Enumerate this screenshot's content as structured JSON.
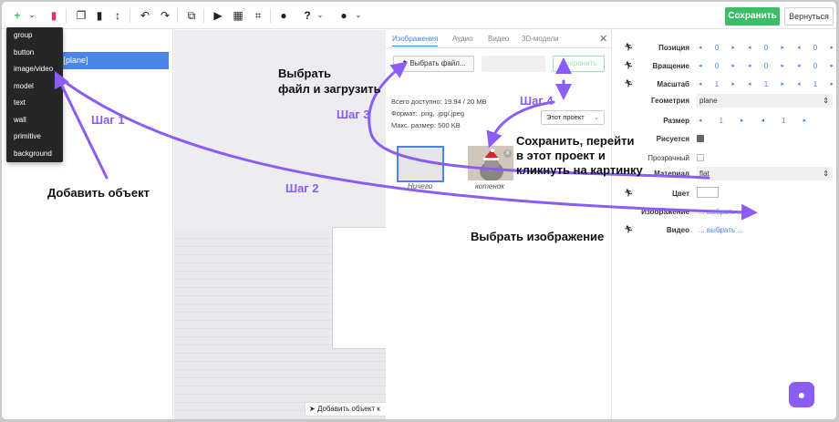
{
  "toolbar": {
    "add_icon": "plus-icon",
    "save_label": "Сохранить",
    "back_label": "Вернуться"
  },
  "add_menu": {
    "items": [
      "group",
      "button",
      "image/video",
      "model",
      "text",
      "wall",
      "primitive",
      "background"
    ]
  },
  "tree": {
    "selected_item": "[window] [plane]"
  },
  "scene": {
    "add_object_hint": "Добавить объект к"
  },
  "media_panel": {
    "tabs": [
      "Изображения",
      "Аудио",
      "Видео",
      "3D-модели"
    ],
    "choose_file_label": "Выбрать файл...",
    "save_label": "Сохранить",
    "available": "Всего доступно: 19.94 / 20 MB",
    "formats": "Формат: .png, .jpg/.jpeg",
    "max_size": "Макс. размер: 500 KB",
    "project_select": "Этот проект",
    "thumbnails": [
      {
        "caption": "Ничего"
      },
      {
        "caption": "котенок"
      }
    ]
  },
  "properties": {
    "position": {
      "label": "Позиция",
      "values": [
        "0",
        "0",
        "0"
      ]
    },
    "rotation": {
      "label": "Вращение",
      "values": [
        "0",
        "0",
        "0"
      ]
    },
    "scale": {
      "label": "Масштаб",
      "values": [
        "1",
        "1",
        "1"
      ]
    },
    "geometry": {
      "label": "Геометрия",
      "value": "plane"
    },
    "size": {
      "label": "Размер",
      "values": [
        "1",
        "1"
      ]
    },
    "visible": {
      "label": "Рисуется",
      "checked": true
    },
    "transparent": {
      "label": "Прозрачный",
      "checked": false
    },
    "material": {
      "label": "Материал",
      "value": "flat"
    },
    "color": {
      "label": "Цвет",
      "value": "#ffffff"
    },
    "image": {
      "label": "Изображение",
      "link": "... выбрать ..."
    },
    "video": {
      "label": "Видео",
      "link": "... выбрать ..."
    }
  },
  "annotations": {
    "add_object": "Добавить объект",
    "choose_upload_1": "Выбрать",
    "choose_upload_2": "файл и загрузить",
    "save_go_1": "Сохранить, перейти",
    "save_go_2": "в этот проект и",
    "save_go_3": "кликнуть на картинку",
    "choose_image": "Выбрать изображение",
    "step1": "Шаг 1",
    "step2": "Шаг 2",
    "step3": "Шаг 3",
    "step4": "Шаг 4"
  },
  "colors": {
    "accent": "#4a86e8",
    "save_green": "#3dbc6a",
    "annotation_purple": "#8b5cf6"
  }
}
